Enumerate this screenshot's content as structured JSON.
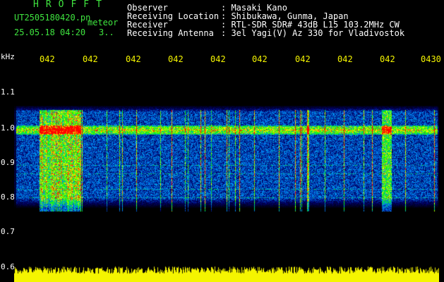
{
  "header": {
    "app_title": "HROFFT",
    "file_name": "UT2505180420.pn",
    "meteor_label": "meteor",
    "date_time": "25.05.18 04:20",
    "count": "3.."
  },
  "info": [
    {
      "label": "Observer",
      "value": ": Masaki Kano"
    },
    {
      "label": "Receiving Location",
      "value": ": Shibukawa, Gunma, Japan"
    },
    {
      "label": "Receiver",
      "value": ": RTL-SDR SDR# 43dB L15 103.2MHz CW"
    },
    {
      "label": "Receiving Antenna",
      "value": ": 3el Yagi(V) Az 330 for Vladivostok"
    }
  ],
  "axis": {
    "y_unit": "kHz",
    "y_ticks": [
      "1.1",
      "1.0",
      "0.9",
      "0.8",
      "0.7",
      "0.6"
    ],
    "x_ticks": [
      "042",
      "042",
      "042",
      "042",
      "042",
      "042",
      "042",
      "042",
      "042",
      "0430"
    ]
  },
  "colors": {
    "background": "#000000",
    "text_green": "#3fe43f",
    "text_white": "#ffffff",
    "text_yellow": "#f5f500",
    "power_yellow": "#f5f500"
  }
}
